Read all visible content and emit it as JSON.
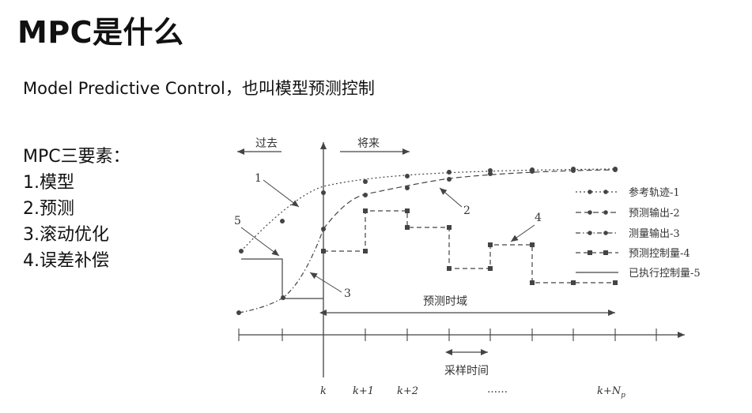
{
  "slide": {
    "title": "MPC是什么",
    "subtitle": "Model Predictive Control，也叫模型预测控制",
    "elements_heading": "MPC三要素：",
    "elements": [
      "1.模型",
      "2.预测",
      "3.滚动优化",
      "4.误差补偿"
    ]
  },
  "diagram": {
    "past_label": "过去",
    "future_label": "将来",
    "legend": [
      {
        "label": "参考轨迹-1",
        "style": "dotted-with-dots"
      },
      {
        "label": "预测输出-2",
        "style": "dashed-with-dots"
      },
      {
        "label": "测量输出-3",
        "style": "dashdot-with-dots"
      },
      {
        "label": "预测控制量-4",
        "style": "dashed-with-squares"
      },
      {
        "label": "已执行控制量-5",
        "style": "solid"
      }
    ],
    "callouts": [
      "1",
      "2",
      "3",
      "4",
      "5"
    ],
    "prediction_horizon_label": "预测时域",
    "sampling_time_label": "采样时间",
    "axis_ticks": [
      "k",
      "k+1",
      "k+2",
      "……",
      "k+N"
    ],
    "axis_tick_subscript": "p",
    "colors": {
      "line": "#444444",
      "text": "#333333",
      "title": "#111111"
    }
  }
}
